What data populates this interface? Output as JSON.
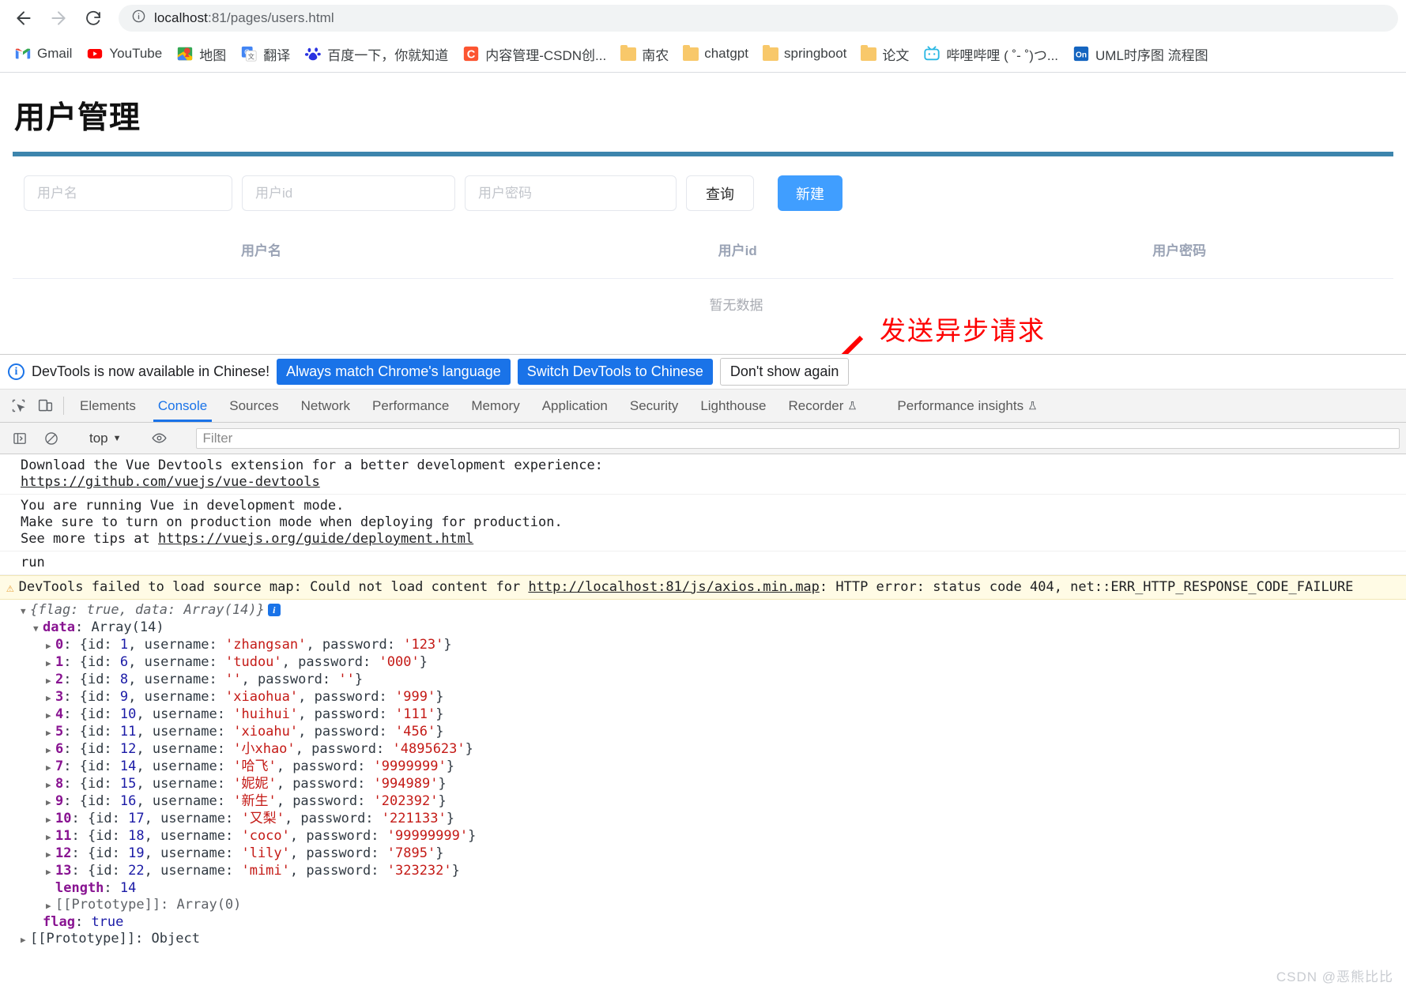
{
  "browser": {
    "back_title": "Back",
    "forward_title": "Forward",
    "reload_title": "Reload",
    "site_info_title": "View site information",
    "url_host": "localhost",
    "url_path": ":81/pages/users.html",
    "url_full": "localhost:81/pages/users.html"
  },
  "bookmarks": [
    {
      "label": "Gmail",
      "icon": "gmail-icon"
    },
    {
      "label": "YouTube",
      "icon": "youtube-icon"
    },
    {
      "label": "地图",
      "icon": "google-maps-icon"
    },
    {
      "label": "翻译",
      "icon": "google-translate-icon"
    },
    {
      "label": "百度一下，你就知道",
      "icon": "baidu-icon"
    },
    {
      "label": "内容管理-CSDN创...",
      "icon": "csdn-icon"
    },
    {
      "label": "南农",
      "icon": "folder-icon"
    },
    {
      "label": "chatgpt",
      "icon": "folder-icon"
    },
    {
      "label": "springboot",
      "icon": "folder-icon"
    },
    {
      "label": "论文",
      "icon": "folder-icon"
    },
    {
      "label": "哔哩哔哩 ( ˚- ˚)つ...",
      "icon": "bilibili-icon"
    },
    {
      "label": "UML时序图 流程图",
      "icon": "onenote-icon"
    }
  ],
  "page": {
    "title": "用户管理",
    "accent_divider_color": "#3d85ad",
    "form": {
      "username_placeholder": "用户名",
      "username_value": "",
      "userid_placeholder": "用户id",
      "userid_value": "",
      "password_placeholder": "用户密码",
      "password_value": "",
      "query_button": "查询",
      "create_button": "新建",
      "create_button_color": "#409eff"
    },
    "table": {
      "columns": [
        "用户名",
        "用户id",
        "用户密码"
      ],
      "rows": [],
      "empty_text": "暂无数据"
    }
  },
  "annotation": {
    "text": "发送异步请求",
    "color": "#fe0000"
  },
  "watermark": "CSDN @恶熊比比",
  "devtools": {
    "banner": {
      "icon": "info-icon",
      "message": "DevTools is now available in Chinese!",
      "primary_button": "Always match Chrome's language",
      "secondary_button": "Switch DevTools to Chinese",
      "dismiss_button": "Don't show again"
    },
    "tabs": [
      {
        "label": "Elements",
        "active": false
      },
      {
        "label": "Console",
        "active": true
      },
      {
        "label": "Sources",
        "active": false
      },
      {
        "label": "Network",
        "active": false
      },
      {
        "label": "Performance",
        "active": false
      },
      {
        "label": "Memory",
        "active": false
      },
      {
        "label": "Application",
        "active": false
      },
      {
        "label": "Security",
        "active": false
      },
      {
        "label": "Lighthouse",
        "active": false
      },
      {
        "label": "Recorder",
        "active": false,
        "badge": "experiment-icon"
      },
      {
        "label": "Performance insights",
        "active": false,
        "badge": "experiment-icon"
      }
    ],
    "toolbar": {
      "sidebar_toggle": "sidebar-toggle-icon",
      "clear_console": "clear-console-icon",
      "context": "top",
      "eye": "live-expression-icon",
      "filter_placeholder": "Filter",
      "filter_value": ""
    },
    "console": {
      "messages": [
        {
          "type": "log",
          "line1": "Download the Vue Devtools extension for a better development experience:",
          "link": "https://github.com/vuejs/vue-devtools"
        },
        {
          "type": "log",
          "line1": "You are running Vue in development mode.",
          "line2": "Make sure to turn on production mode when deploying for production.",
          "line3_prefix": "See more tips at ",
          "link": "https://vuejs.org/guide/deployment.html"
        },
        {
          "type": "log",
          "text": "run"
        }
      ],
      "warning": {
        "icon": "warning-triangle-icon",
        "prefix": "DevTools failed to load source map: Could not load content for ",
        "link": "http://localhost:81/js/axios.min.map",
        "suffix": ": HTTP error: status code 404, net::ERR_HTTP_RESPONSE_CODE_FAILURE"
      },
      "object_preview": "{flag: true, data: Array(14)}",
      "data_label": "data",
      "data_type": "Array(14)",
      "entries": [
        {
          "index": "0",
          "id": "1",
          "username": "zhangsan",
          "password": "123"
        },
        {
          "index": "1",
          "id": "6",
          "username": "tudou",
          "password": "000"
        },
        {
          "index": "2",
          "id": "8",
          "username": "",
          "password": ""
        },
        {
          "index": "3",
          "id": "9",
          "username": "xiaohua",
          "password": "999"
        },
        {
          "index": "4",
          "id": "10",
          "username": "huihui",
          "password": "111"
        },
        {
          "index": "5",
          "id": "11",
          "username": "xioahu",
          "password": "456"
        },
        {
          "index": "6",
          "id": "12",
          "username": "小xhao",
          "password": "4895623"
        },
        {
          "index": "7",
          "id": "14",
          "username": "哈飞",
          "password": "9999999"
        },
        {
          "index": "8",
          "id": "15",
          "username": "妮妮",
          "password": "994989"
        },
        {
          "index": "9",
          "id": "16",
          "username": "新生",
          "password": "202392"
        },
        {
          "index": "10",
          "id": "17",
          "username": "又梨",
          "password": "221133"
        },
        {
          "index": "11",
          "id": "18",
          "username": "coco",
          "password": "99999999"
        },
        {
          "index": "12",
          "id": "19",
          "username": "lily",
          "password": "7895"
        },
        {
          "index": "13",
          "id": "22",
          "username": "mimi",
          "password": "323232"
        }
      ],
      "length_key": "length",
      "length_value": "14",
      "proto_array": "[[Prototype]]: Array(0)",
      "flag_key": "flag",
      "flag_value": "true",
      "proto_object": "[[Prototype]]: Object"
    }
  }
}
